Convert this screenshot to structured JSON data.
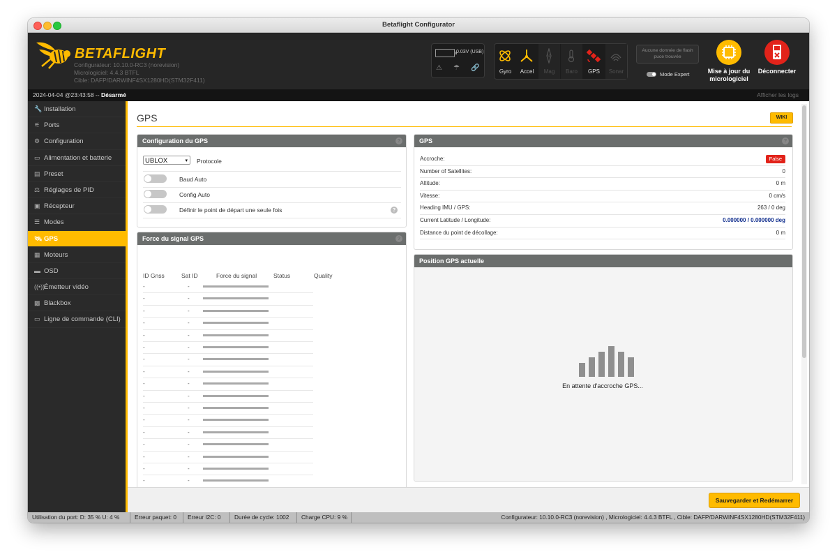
{
  "window": {
    "title": "Betaflight Configurator"
  },
  "header": {
    "logo_text": "BETAFLIGHT",
    "configurator": "Configurateur: 10.10.0-RC3 (norevision)",
    "firmware": "Micrologiciel: 4.4.3 BTFL",
    "target": "Cible: DAFP/DARWINF4SX1280HD(STM32F411)",
    "battery": "0.03V (USB)",
    "sensors": [
      {
        "label": "Gyro",
        "active": true
      },
      {
        "label": "Accel",
        "active": true
      },
      {
        "label": "Mag",
        "active": false
      },
      {
        "label": "Baro",
        "active": false
      },
      {
        "label": "GPS",
        "active": true
      },
      {
        "label": "Sonar",
        "active": false
      }
    ],
    "flash_line1": "Aucune donnée de flash",
    "flash_line2": "puce trouvée",
    "expert_mode": "Mode Expert",
    "update_line1": "Mise à jour du",
    "update_line2": "micrologiciel",
    "disconnect": "Déconnecter",
    "colors": {
      "accent": "#ffbb00",
      "disconnect": "#e2231a"
    }
  },
  "subbar": {
    "datetime": "2024-04-04 @23:43:58 -- ",
    "state": "Désarmé",
    "show_logs": "Afficher les logs"
  },
  "sidebar": {
    "items": [
      {
        "label": "Installation",
        "icon": "wrench-icon"
      },
      {
        "label": "Ports",
        "icon": "plug-icon"
      },
      {
        "label": "Configuration",
        "icon": "gear-icon"
      },
      {
        "label": "Alimentation et batterie",
        "icon": "battery-icon"
      },
      {
        "label": "Preset",
        "icon": "preset-icon"
      },
      {
        "label": "Réglages de PID",
        "icon": "pid-icon"
      },
      {
        "label": "Récepteur",
        "icon": "receiver-icon"
      },
      {
        "label": "Modes",
        "icon": "modes-icon"
      },
      {
        "label": "GPS",
        "icon": "satellite-icon",
        "active": true
      },
      {
        "label": "Moteurs",
        "icon": "motor-icon"
      },
      {
        "label": "OSD",
        "icon": "osd-icon"
      },
      {
        "label": "Émetteur vidéo",
        "icon": "antenna-icon"
      },
      {
        "label": "Blackbox",
        "icon": "blackbox-icon"
      },
      {
        "label": "Ligne de commande (CLI)",
        "icon": "cli-icon"
      }
    ]
  },
  "main": {
    "title": "GPS",
    "wiki": "WIKI",
    "config_panel": {
      "title": "Configuration du GPS",
      "protocol_value": "UBLOX",
      "protocol_label": "Protocole",
      "baud_auto": "Baud Auto",
      "config_auto": "Config Auto",
      "home_once": "Définir le point de départ une seule fois"
    },
    "signal_panel": {
      "title": "Force du signal GPS",
      "columns": [
        "ID Gnss",
        "Sat ID",
        "Force du signal",
        "Status",
        "Quality"
      ],
      "rows": [
        {
          "gnss": "-",
          "sat": "-",
          "strength": 0
        },
        {
          "gnss": "-",
          "sat": "-",
          "strength": 0
        },
        {
          "gnss": "-",
          "sat": "-",
          "strength": 0
        },
        {
          "gnss": "-",
          "sat": "-",
          "strength": 0
        },
        {
          "gnss": "-",
          "sat": "-",
          "strength": 0
        },
        {
          "gnss": "-",
          "sat": "-",
          "strength": 0
        },
        {
          "gnss": "-",
          "sat": "-",
          "strength": 0
        },
        {
          "gnss": "-",
          "sat": "-",
          "strength": 0
        },
        {
          "gnss": "-",
          "sat": "-",
          "strength": 0
        },
        {
          "gnss": "-",
          "sat": "-",
          "strength": 0
        },
        {
          "gnss": "-",
          "sat": "-",
          "strength": 0
        },
        {
          "gnss": "-",
          "sat": "-",
          "strength": 0
        },
        {
          "gnss": "-",
          "sat": "-",
          "strength": 0
        },
        {
          "gnss": "-",
          "sat": "-",
          "strength": 0
        },
        {
          "gnss": "-",
          "sat": "-",
          "strength": 0
        },
        {
          "gnss": "-",
          "sat": "-",
          "strength": 0
        },
        {
          "gnss": "-",
          "sat": "-",
          "strength": 0
        },
        {
          "gnss": "-",
          "sat": "-",
          "strength": 0
        }
      ]
    },
    "gps_panel": {
      "title": "GPS",
      "rows": [
        {
          "label": "Accroche:",
          "value": "False",
          "type": "badge"
        },
        {
          "label": "Number of Satellites:",
          "value": "0"
        },
        {
          "label": "Altitude:",
          "value": "0 m"
        },
        {
          "label": "Vitesse:",
          "value": "0 cm/s"
        },
        {
          "label": "Heading IMU / GPS:",
          "value": "263 / 0 deg"
        },
        {
          "label": "Current Latitude / Longitude:",
          "value": "0.000000 / 0.000000 deg",
          "type": "coord"
        },
        {
          "label": "Distance du point de décollage:",
          "value": "0 m"
        }
      ]
    },
    "position_panel": {
      "title": "Position GPS actuelle",
      "waiting": "En attente d'accroche GPS..."
    },
    "save_button": "Sauvegarder et Redémarrer"
  },
  "statusbar": {
    "port_usage": "Utilisation du port: D: 35 % U: 4 %",
    "packet_error": "Erreur paquet: 0",
    "i2c_error": "Erreur I2C: 0",
    "cycle_time": "Durée de cycle: 1002",
    "cpu_load": "Charge CPU: 9 %",
    "version": "Configurateur: 10.10.0-RC3 (norevision) , Micrologiciel: 4.4.3 BTFL , Cible: DAFP/DARWINF4SX1280HD(STM32F411)"
  }
}
